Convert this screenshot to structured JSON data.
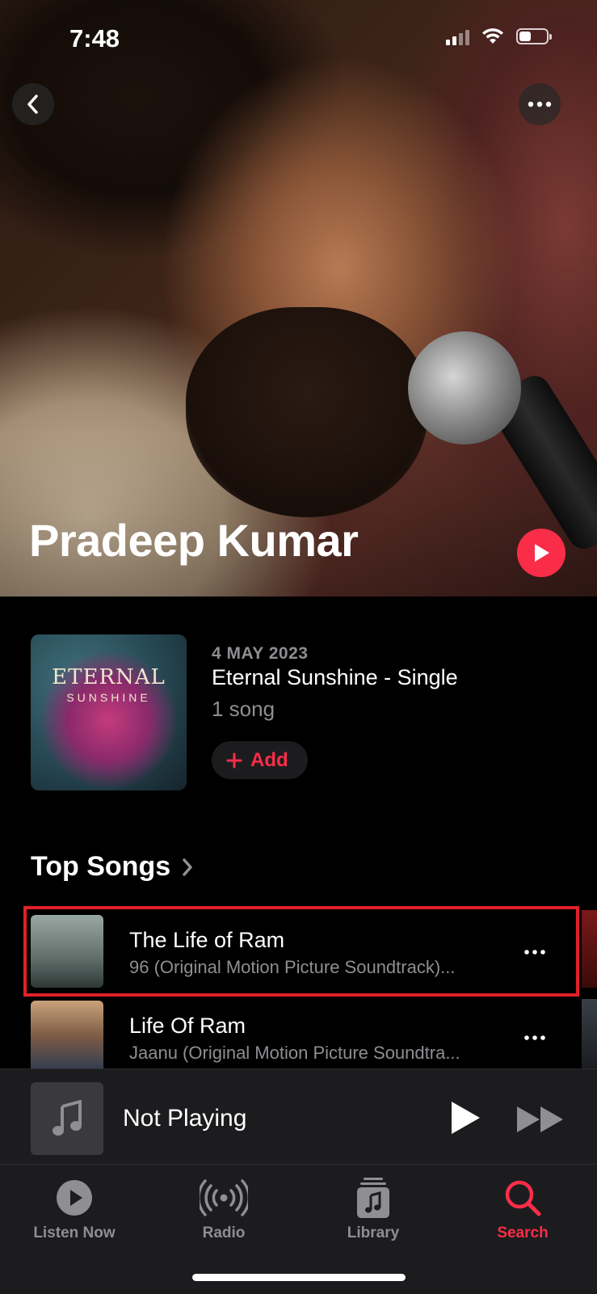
{
  "status_bar": {
    "time": "7:48"
  },
  "artist": {
    "name": "Pradeep Kumar"
  },
  "latest_release": {
    "date": "4 MAY 2023",
    "title": "Eternal Sunshine - Single",
    "count": "1 song",
    "add_label": "Add",
    "art_title": "ETERNAL",
    "art_subtitle": "SUNSHINE"
  },
  "top_songs": {
    "title": "Top Songs",
    "songs": [
      {
        "title": "The Life of Ram",
        "subtitle": "96 (Original Motion Picture Soundtrack)..."
      },
      {
        "title": "Life Of Ram",
        "subtitle": "Jaanu (Original Motion Picture Soundtra..."
      }
    ]
  },
  "mini_player": {
    "title": "Not Playing"
  },
  "tabs": [
    {
      "label": "Listen Now",
      "icon": "play-circle-icon"
    },
    {
      "label": "Radio",
      "icon": "radio-waves-icon"
    },
    {
      "label": "Library",
      "icon": "library-icon"
    },
    {
      "label": "Search",
      "icon": "search-icon"
    }
  ],
  "colors": {
    "accent": "#fa2d48",
    "highlight": "#e0202a",
    "background": "#000000",
    "secondary_text": "#8e8e93"
  }
}
